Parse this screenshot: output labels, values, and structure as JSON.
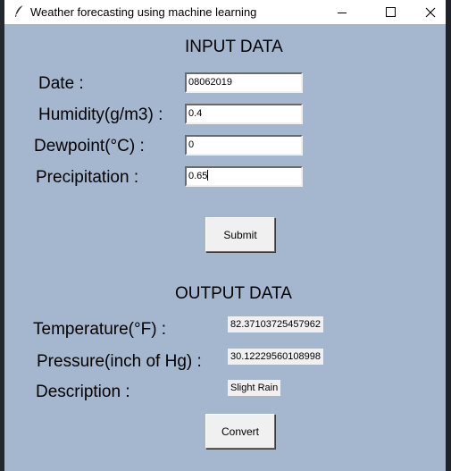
{
  "window": {
    "title": "Weather forecasting using machine learning",
    "app_icon": "feather-icon",
    "controls": [
      "minimize-icon",
      "maximize-icon",
      "close-icon"
    ]
  },
  "input": {
    "heading": "INPUT DATA",
    "date_label": "Date :",
    "date_value": "08062019",
    "humidity_label": "Humidity(g/m3) :",
    "humidity_value": "0.4",
    "dewpoint_label": "Dewpoint(°C) :",
    "dewpoint_value": "0",
    "precipitation_label": "Precipitation :",
    "precipitation_value": "0.65",
    "submit_label": "Submit"
  },
  "output": {
    "heading": "OUTPUT DATA",
    "temperature_label": "Temperature(°F) :",
    "temperature_value": "82.37103725457962",
    "pressure_label": "Pressure(inch of Hg) :",
    "pressure_value": "30.12229560108998",
    "description_label": "Description :",
    "description_value": "Slight Rain",
    "convert_label": "Convert"
  },
  "colors": {
    "window_background": "#a4b7cf",
    "titlebar": "#ffffff",
    "button": "#f0f0f0"
  }
}
